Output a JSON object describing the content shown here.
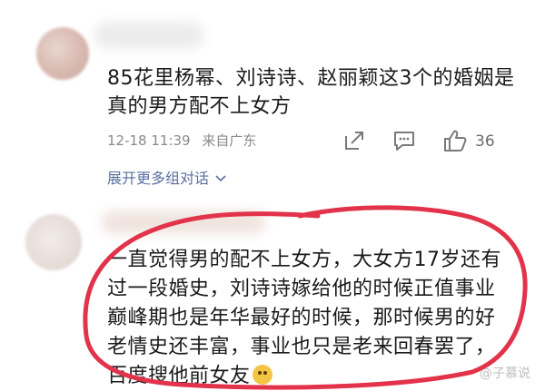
{
  "comment1": {
    "text": "85花里杨幂、刘诗诗、赵丽颖这3个的婚姻是真的男方配不上女方",
    "time": "12-18 11:39",
    "location": "来自广东",
    "like_count": "36",
    "expand_label": "展开更多组对话"
  },
  "comment2": {
    "text": "一直觉得男的配不上女方，大女方17岁还有过一段婚史，刘诗诗嫁给他的时候正值事业巅峰期也是年华最好的时候，那时候男的好老情史还丰富，事业也只是老来回春罢了，百度搜他前女友"
  },
  "watermark": "@子慕说",
  "colors": {
    "highlight_circle": "#e2334a",
    "link": "#5a6f9e"
  }
}
